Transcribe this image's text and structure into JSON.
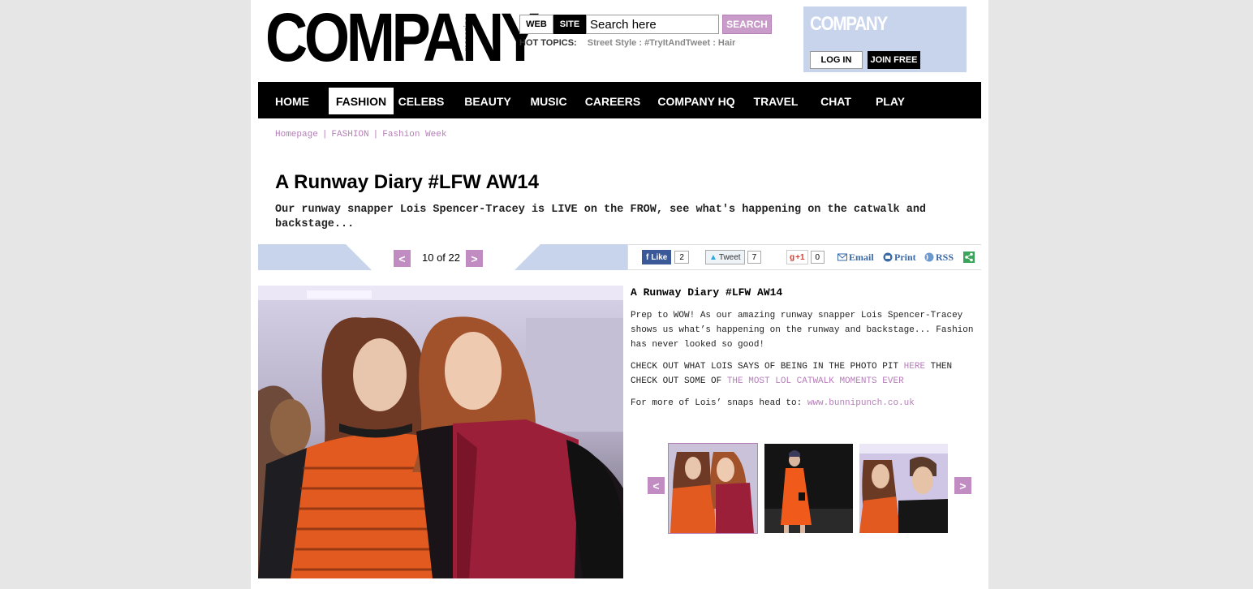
{
  "header": {
    "logo_text": "COMPANY",
    "logo_sub": "magazine",
    "search": {
      "web_label": "WEB",
      "site_label": "SITE",
      "placeholder": "Search here",
      "button_label": "SEARCH"
    },
    "hot_topics": {
      "label": "HOT TOPICS:",
      "items": "Street Style : #TryItAndTweet : Hair"
    },
    "account": {
      "logo_text": "COMPANY",
      "login_label": "LOG IN",
      "join_label": "JOIN FREE"
    }
  },
  "nav": {
    "items": [
      {
        "label": "HOME"
      },
      {
        "label": "FASHION"
      },
      {
        "label": "CELEBS"
      },
      {
        "label": "BEAUTY"
      },
      {
        "label": "MUSIC"
      },
      {
        "label": "CAREERS"
      },
      {
        "label": "COMPANY HQ"
      },
      {
        "label": "TRAVEL"
      },
      {
        "label": "CHAT"
      },
      {
        "label": "PLAY"
      }
    ],
    "active": "FASHION"
  },
  "breadcrumb": {
    "items": [
      {
        "label": "Homepage"
      },
      {
        "label": "FASHION"
      },
      {
        "label": "Fashion Week"
      }
    ],
    "separator": "|"
  },
  "article": {
    "title": "A Runway Diary #LFW AW14",
    "standfirst": "Our runway snapper Lois Spencer-Tracey is LIVE on the FROW, see what's happening on the catwalk and backstage..."
  },
  "gallery": {
    "counter": "10 of 22",
    "prev_glyph": "<",
    "next_glyph": ">",
    "slide_title": "A Runway Diary #LFW AW14",
    "para1": "Prep to WOW! As our amazing runway snapper Lois Spencer-Tracey shows us what’s happening on the runway and backstage... Fashion has never looked so good!",
    "para2_a": "CHECK OUT WHAT LOIS SAYS OF BEING IN THE PHOTO PIT ",
    "para2_link1": "HERE",
    "para2_b": " THEN CHECK OUT SOME OF ",
    "para2_link2": "THE MOST LOL CATWALK MOMENTS EVER",
    "para3_a": "For more of Lois’ snaps head to: ",
    "para3_link": "www.bunnipunch.co.uk"
  },
  "share": {
    "fb_label": "Like",
    "fb_count": "2",
    "tw_label": "Tweet",
    "tw_count": "7",
    "gp_label": "+1",
    "gp_count": "0",
    "email_label": "Email",
    "print_label": "Print",
    "rss_label": "RSS"
  },
  "colors": {
    "accent": "#c08cc2",
    "link": "#b67fb8",
    "panel": "#c8d3ec",
    "nav_bg": "#000000"
  }
}
